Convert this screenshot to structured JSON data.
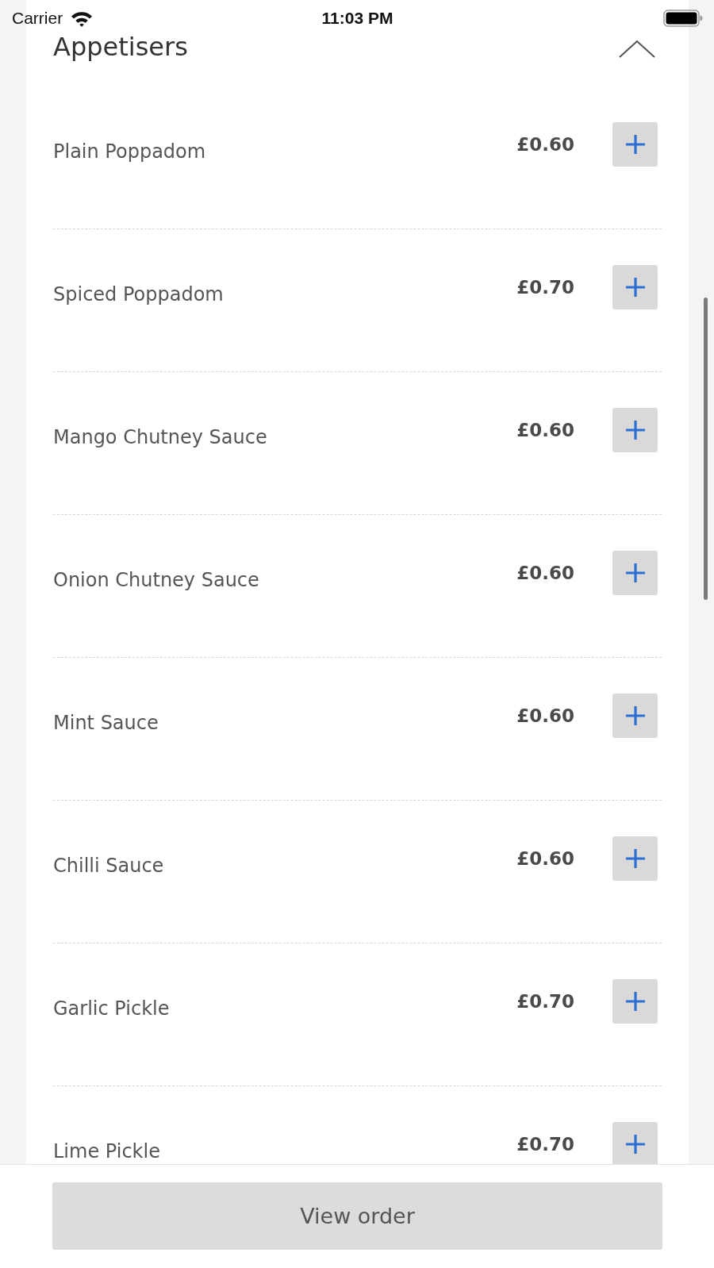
{
  "status_bar": {
    "carrier": "Carrier",
    "time": "11:03 PM"
  },
  "section": {
    "title": "Appetisers",
    "expanded": true,
    "items": [
      {
        "name": "Plain Poppadom",
        "price": "£0.60"
      },
      {
        "name": "Spiced Poppadom",
        "price": "£0.70"
      },
      {
        "name": "Mango Chutney Sauce",
        "price": "£0.60"
      },
      {
        "name": "Onion Chutney Sauce",
        "price": "£0.60"
      },
      {
        "name": "Mint Sauce",
        "price": "£0.60"
      },
      {
        "name": "Chilli Sauce",
        "price": "£0.60"
      },
      {
        "name": "Garlic Pickle",
        "price": "£0.70"
      },
      {
        "name": "Lime Pickle",
        "price": "£0.70"
      }
    ]
  },
  "bottom_bar": {
    "button": "View order"
  }
}
